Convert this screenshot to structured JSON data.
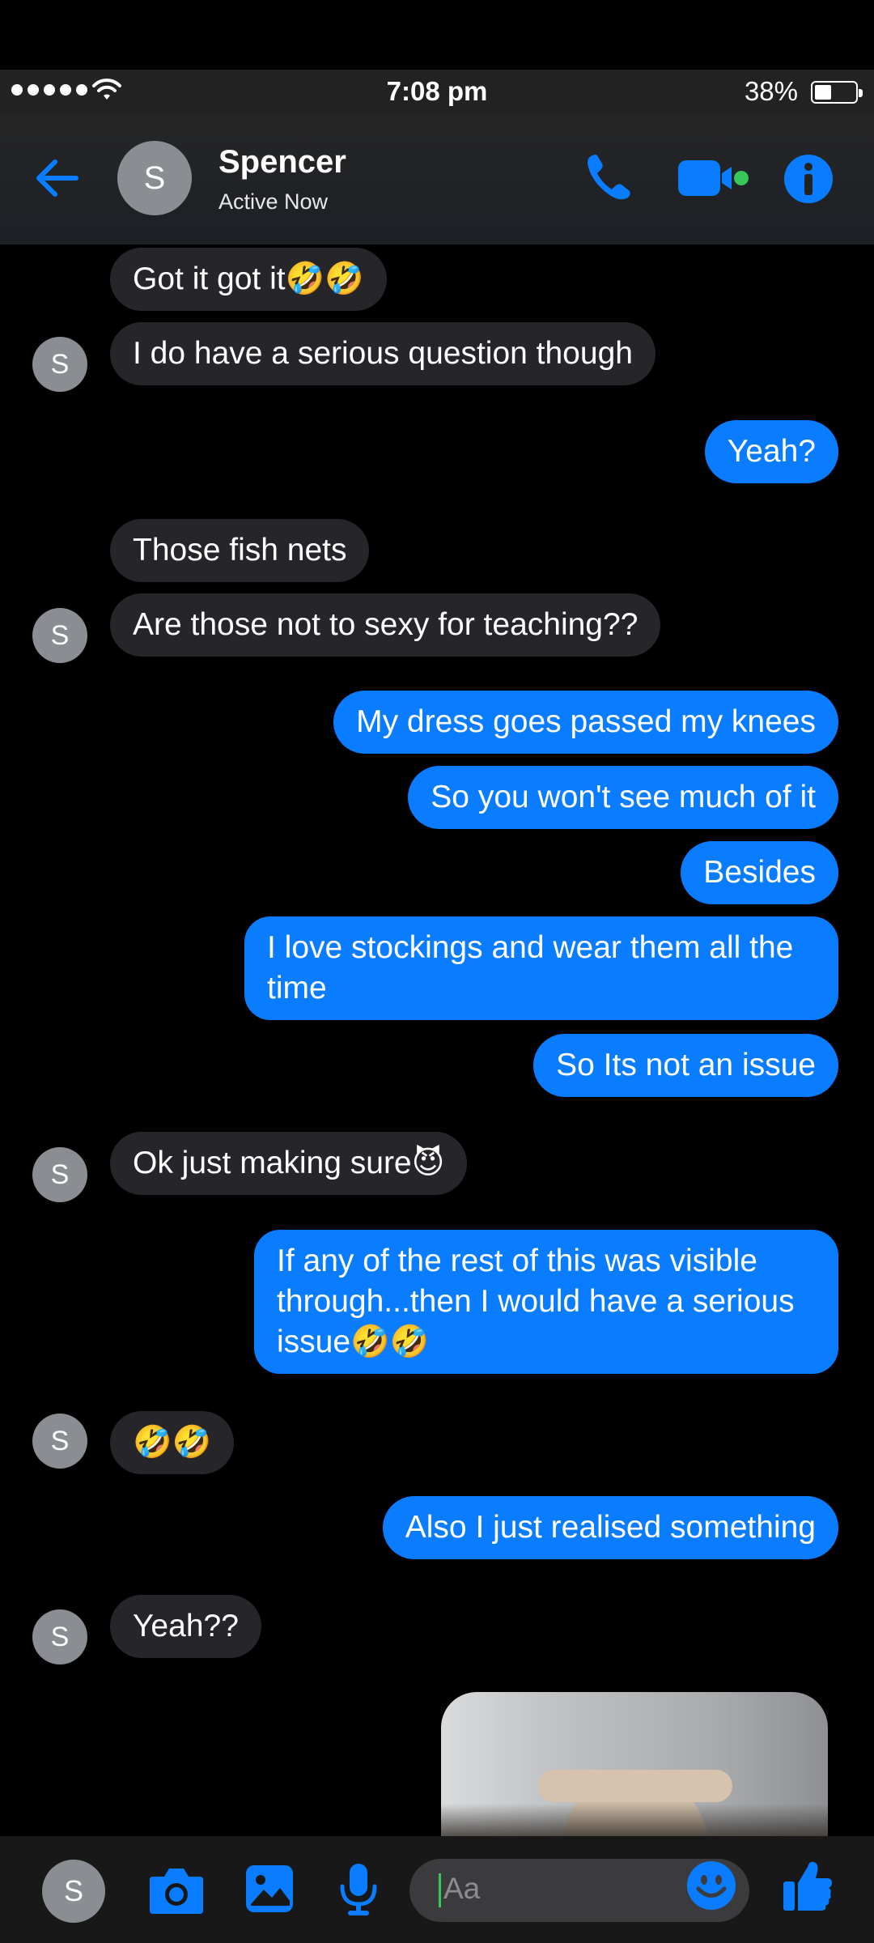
{
  "status_bar": {
    "time": "7:08 pm",
    "battery": "38%"
  },
  "header": {
    "avatar_initial": "S",
    "name": "Spencer",
    "status": "Active Now"
  },
  "messages": [
    {
      "from": "them",
      "text": "Got it got it🤣🤣"
    },
    {
      "from": "them",
      "text": "I do have a serious question though"
    },
    {
      "from": "me",
      "text": "Yeah?"
    },
    {
      "from": "them",
      "text": "Those fish nets"
    },
    {
      "from": "them",
      "text": "Are those not to sexy for teaching??"
    },
    {
      "from": "me",
      "text": "My dress goes passed my knees"
    },
    {
      "from": "me",
      "text": "So you won't see much of it"
    },
    {
      "from": "me",
      "text": "Besides"
    },
    {
      "from": "me",
      "text": "I love stockings and wear them all the time"
    },
    {
      "from": "me",
      "text": "So Its not an issue"
    },
    {
      "from": "them",
      "text": "Ok just making sure😈"
    },
    {
      "from": "me",
      "text": "If any of the rest of this was visible through...then I would have a serious issue🤣🤣"
    },
    {
      "from": "them",
      "text": "🤣🤣"
    },
    {
      "from": "me",
      "text": "Also I just realised something"
    },
    {
      "from": "them",
      "text": "Yeah??"
    }
  ],
  "avatar_initial": "S",
  "composer": {
    "placeholder": "Aa",
    "avatar_initial": "S"
  },
  "colors": {
    "accent": "#0a7cff",
    "received_bubble": "#26252a",
    "online_dot": "#35c759"
  },
  "icons": [
    "back-arrow-icon",
    "phone-icon",
    "video-camera-icon",
    "info-icon",
    "camera-icon",
    "image-icon",
    "microphone-icon",
    "smiley-icon",
    "thumbs-up-icon",
    "wifi-icon",
    "battery-icon"
  ]
}
